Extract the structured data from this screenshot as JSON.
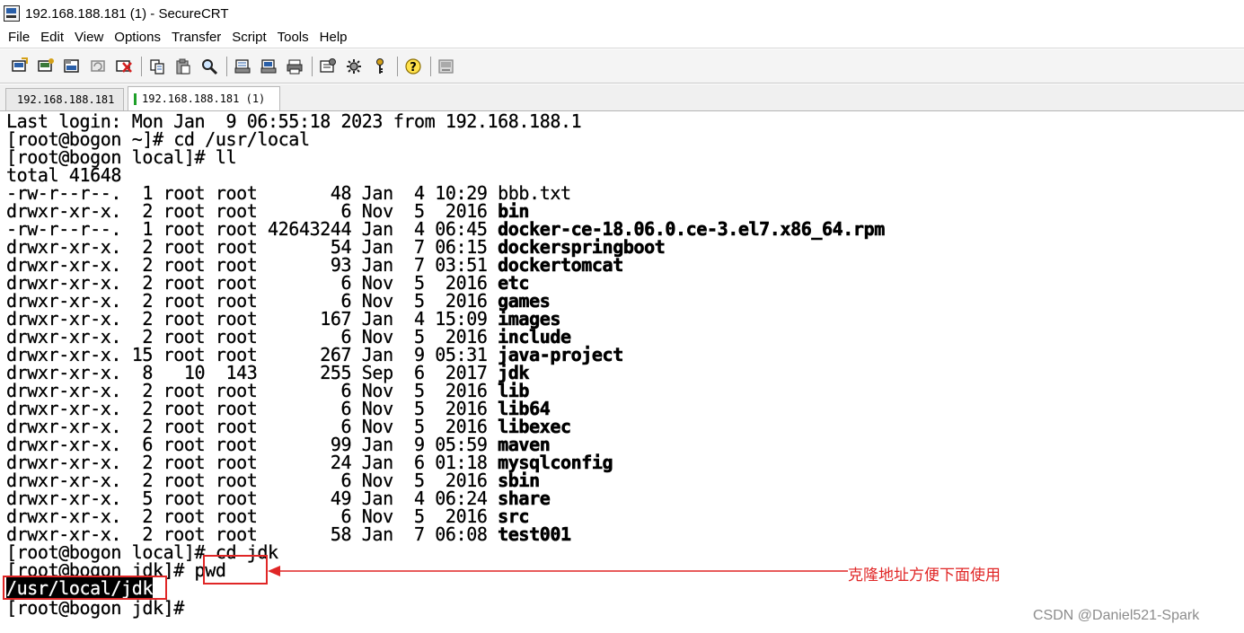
{
  "window": {
    "title": "192.168.188.181 (1) - SecureCRT"
  },
  "menu": [
    "File",
    "Edit",
    "View",
    "Options",
    "Transfer",
    "Script",
    "Tools",
    "Help"
  ],
  "toolbar": {
    "groups": [
      [
        "connect-icon",
        "quick-connect-icon",
        "connect-in-tab-icon",
        "reconnect-icon",
        "disconnect-icon"
      ],
      [
        "copy-icon",
        "paste-icon",
        "find-icon"
      ],
      [
        "print-icon",
        "print-selection-icon",
        "printer-setup-icon"
      ],
      [
        "session-options-icon",
        "global-options-icon",
        "keymap-icon"
      ],
      [
        "help-icon"
      ],
      [
        "sftp-icon"
      ]
    ]
  },
  "tabs": [
    {
      "label": "192.168.188.181",
      "active": false,
      "status_color": "#1fa02a"
    },
    {
      "label": "192.168.188.181  (1)",
      "active": true,
      "status_color": "#1fa02a"
    }
  ],
  "terminal": {
    "last_login": "Last login: Mon Jan  9 06:55:18 2023 from 192.168.188.1",
    "prompt1": "[root@bogon ~]# cd /usr/local",
    "prompt2": "[root@bogon local]# ll",
    "total": "total 41648",
    "listing": [
      {
        "meta": "-rw-r--r--.  1 root root       48 Jan  4 10:29 ",
        "name": "bbb.txt",
        "bold": false
      },
      {
        "meta": "drwxr-xr-x.  2 root root        6 Nov  5  2016 ",
        "name": "bin",
        "bold": true
      },
      {
        "meta": "-rw-r--r--.  1 root root 42643244 Jan  4 06:45 ",
        "name": "docker-ce-18.06.0.ce-3.el7.x86_64.rpm",
        "bold": true
      },
      {
        "meta": "drwxr-xr-x.  2 root root       54 Jan  7 06:15 ",
        "name": "dockerspringboot",
        "bold": true
      },
      {
        "meta": "drwxr-xr-x.  2 root root       93 Jan  7 03:51 ",
        "name": "dockertomcat",
        "bold": true
      },
      {
        "meta": "drwxr-xr-x.  2 root root        6 Nov  5  2016 ",
        "name": "etc",
        "bold": true
      },
      {
        "meta": "drwxr-xr-x.  2 root root        6 Nov  5  2016 ",
        "name": "games",
        "bold": true
      },
      {
        "meta": "drwxr-xr-x.  2 root root      167 Jan  4 15:09 ",
        "name": "images",
        "bold": true
      },
      {
        "meta": "drwxr-xr-x.  2 root root        6 Nov  5  2016 ",
        "name": "include",
        "bold": true
      },
      {
        "meta": "drwxr-xr-x. 15 root root      267 Jan  9 05:31 ",
        "name": "java-project",
        "bold": true
      },
      {
        "meta": "drwxr-xr-x.  8   10  143      255 Sep  6  2017 ",
        "name": "jdk",
        "bold": true
      },
      {
        "meta": "drwxr-xr-x.  2 root root        6 Nov  5  2016 ",
        "name": "lib",
        "bold": true
      },
      {
        "meta": "drwxr-xr-x.  2 root root        6 Nov  5  2016 ",
        "name": "lib64",
        "bold": true
      },
      {
        "meta": "drwxr-xr-x.  2 root root        6 Nov  5  2016 ",
        "name": "libexec",
        "bold": true
      },
      {
        "meta": "drwxr-xr-x.  6 root root       99 Jan  9 05:59 ",
        "name": "maven",
        "bold": true
      },
      {
        "meta": "drwxr-xr-x.  2 root root       24 Jan  6 01:18 ",
        "name": "mysqlconfig",
        "bold": true
      },
      {
        "meta": "drwxr-xr-x.  2 root root        6 Nov  5  2016 ",
        "name": "sbin",
        "bold": true
      },
      {
        "meta": "drwxr-xr-x.  5 root root       49 Jan  4 06:24 ",
        "name": "share",
        "bold": true
      },
      {
        "meta": "drwxr-xr-x.  2 root root        6 Nov  5  2016 ",
        "name": "src",
        "bold": true
      },
      {
        "meta": "drwxr-xr-x.  2 root root       58 Jan  7 06:08 ",
        "name": "test001",
        "bold": true
      }
    ],
    "prompt3": "[root@bogon local]# cd jdk",
    "prompt4": "[root@bogon jdk]# ",
    "pwd_cmd": "pwd",
    "pwd_output": "/usr/local/jdk",
    "prompt5": "[root@bogon jdk]#"
  },
  "annotation": {
    "text": "克隆地址方便下面使用",
    "color": "#e02626"
  },
  "watermark": "CSDN @Daniel521-Spark"
}
